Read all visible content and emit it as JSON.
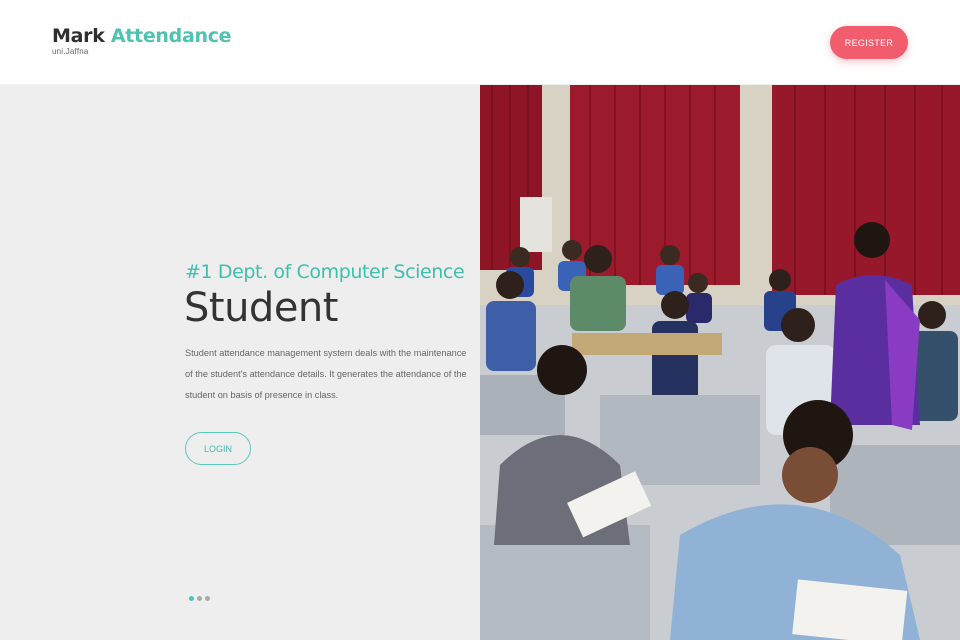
{
  "brand": {
    "title_part1": "Mark",
    "title_part2": "Attendance",
    "subtitle": "uni.Jaffna"
  },
  "nav": {
    "register_label": "REGISTER"
  },
  "hero": {
    "tagline": "#1 Dept. of Computer Science",
    "headline": "Student",
    "description": "Student attendance management system deals with the maintenance of the student's attendance details. It generates the attendance of the student on basis of presence in class.",
    "login_label": "LOGIN",
    "slides": {
      "count": 3,
      "active": 1
    }
  },
  "colors": {
    "accent": "#4fc3b3",
    "register": "#f25d6e",
    "hero_bg": "#eeeeee"
  }
}
